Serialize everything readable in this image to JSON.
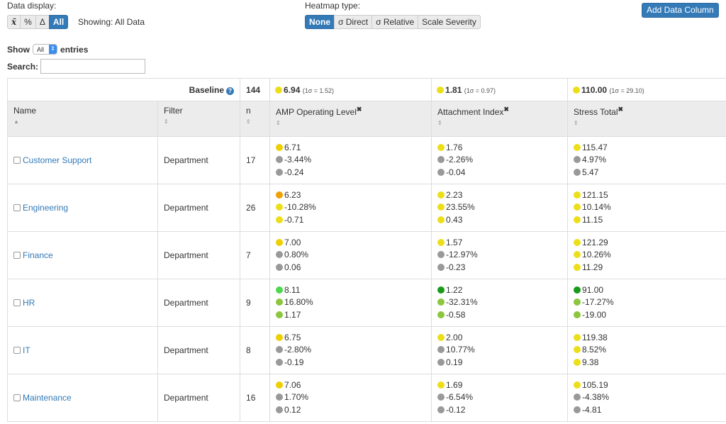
{
  "controls": {
    "data_display_label": "Data display:",
    "data_display_buttons": [
      {
        "label": "x̄",
        "active": false
      },
      {
        "label": "%",
        "active": false
      },
      {
        "label": "Δ",
        "active": false
      },
      {
        "label": "All",
        "active": true
      }
    ],
    "showing_text": "Showing: All Data",
    "heatmap_label": "Heatmap type:",
    "heatmap_buttons": [
      {
        "label": "None",
        "active": true
      },
      {
        "label": "σ Direct",
        "active": false
      },
      {
        "label": "σ Relative",
        "active": false
      },
      {
        "label": "Scale Severity",
        "active": false
      }
    ],
    "add_column_label": "Add Data Column",
    "show_label": "Show",
    "show_value": "All",
    "entries_label": "entries",
    "search_label": "Search:",
    "search_value": ""
  },
  "colors": {
    "yellow": "#ecdf1a",
    "gold": "#f0cf00",
    "orange": "#f0a000",
    "gray": "#999999",
    "lightgreen": "#8cc63e",
    "brightgreen": "#4cd94c",
    "darkgreen": "#1a9a1a",
    "primary": "#337ab7"
  },
  "baseline": {
    "label": "Baseline",
    "n": "144",
    "values": [
      {
        "value": "6.94",
        "sigma": "(1σ = 1.52)",
        "color": "yellow"
      },
      {
        "value": "1.81",
        "sigma": "(1σ = 0.97)",
        "color": "yellow"
      },
      {
        "value": "110.00",
        "sigma": "(1σ = 29.10)",
        "color": "yellow"
      }
    ]
  },
  "columns": [
    {
      "label": "Name",
      "sort": "▲"
    },
    {
      "label": "Filter",
      "sort": "⇕"
    },
    {
      "label": "n",
      "sort": "⇕"
    },
    {
      "label": "AMP Operating Level",
      "sort": "⇕",
      "removable": "✖"
    },
    {
      "label": "Attachment Index",
      "sort": "⇕",
      "removable": "✖"
    },
    {
      "label": "Stress Total",
      "sort": "⇕",
      "removable": "✖"
    }
  ],
  "rows": [
    {
      "name": "Customer Support",
      "filter": "Department",
      "n": "17",
      "metrics": [
        [
          {
            "v": "6.71",
            "c": "gold"
          },
          {
            "v": "-3.44%",
            "c": "gray"
          },
          {
            "v": "-0.24",
            "c": "gray"
          }
        ],
        [
          {
            "v": "1.76",
            "c": "yellow"
          },
          {
            "v": "-2.26%",
            "c": "gray"
          },
          {
            "v": "-0.04",
            "c": "gray"
          }
        ],
        [
          {
            "v": "115.47",
            "c": "yellow"
          },
          {
            "v": "4.97%",
            "c": "gray"
          },
          {
            "v": "5.47",
            "c": "gray"
          }
        ]
      ]
    },
    {
      "name": "Engineering",
      "filter": "Department",
      "n": "26",
      "metrics": [
        [
          {
            "v": "6.23",
            "c": "orange"
          },
          {
            "v": "-10.28%",
            "c": "yellow"
          },
          {
            "v": "-0.71",
            "c": "yellow"
          }
        ],
        [
          {
            "v": "2.23",
            "c": "yellow"
          },
          {
            "v": "23.55%",
            "c": "yellow"
          },
          {
            "v": "0.43",
            "c": "yellow"
          }
        ],
        [
          {
            "v": "121.15",
            "c": "yellow"
          },
          {
            "v": "10.14%",
            "c": "yellow"
          },
          {
            "v": "11.15",
            "c": "yellow"
          }
        ]
      ]
    },
    {
      "name": "Finance",
      "filter": "Department",
      "n": "7",
      "metrics": [
        [
          {
            "v": "7.00",
            "c": "gold"
          },
          {
            "v": "0.80%",
            "c": "gray"
          },
          {
            "v": "0.06",
            "c": "gray"
          }
        ],
        [
          {
            "v": "1.57",
            "c": "yellow"
          },
          {
            "v": "-12.97%",
            "c": "gray"
          },
          {
            "v": "-0.23",
            "c": "gray"
          }
        ],
        [
          {
            "v": "121.29",
            "c": "yellow"
          },
          {
            "v": "10.26%",
            "c": "yellow"
          },
          {
            "v": "11.29",
            "c": "yellow"
          }
        ]
      ]
    },
    {
      "name": "HR",
      "filter": "Department",
      "n": "9",
      "metrics": [
        [
          {
            "v": "8.11",
            "c": "brightgreen"
          },
          {
            "v": "16.80%",
            "c": "lightgreen"
          },
          {
            "v": "1.17",
            "c": "lightgreen"
          }
        ],
        [
          {
            "v": "1.22",
            "c": "darkgreen"
          },
          {
            "v": "-32.31%",
            "c": "lightgreen"
          },
          {
            "v": "-0.58",
            "c": "lightgreen"
          }
        ],
        [
          {
            "v": "91.00",
            "c": "darkgreen"
          },
          {
            "v": "-17.27%",
            "c": "lightgreen"
          },
          {
            "v": "-19.00",
            "c": "lightgreen"
          }
        ]
      ]
    },
    {
      "name": "IT",
      "filter": "Department",
      "n": "8",
      "metrics": [
        [
          {
            "v": "6.75",
            "c": "gold"
          },
          {
            "v": "-2.80%",
            "c": "gray"
          },
          {
            "v": "-0.19",
            "c": "gray"
          }
        ],
        [
          {
            "v": "2.00",
            "c": "yellow"
          },
          {
            "v": "10.77%",
            "c": "gray"
          },
          {
            "v": "0.19",
            "c": "gray"
          }
        ],
        [
          {
            "v": "119.38",
            "c": "yellow"
          },
          {
            "v": "8.52%",
            "c": "yellow"
          },
          {
            "v": "9.38",
            "c": "yellow"
          }
        ]
      ]
    },
    {
      "name": "Maintenance",
      "filter": "Department",
      "n": "16",
      "metrics": [
        [
          {
            "v": "7.06",
            "c": "gold"
          },
          {
            "v": "1.70%",
            "c": "gray"
          },
          {
            "v": "0.12",
            "c": "gray"
          }
        ],
        [
          {
            "v": "1.69",
            "c": "yellow"
          },
          {
            "v": "-6.54%",
            "c": "gray"
          },
          {
            "v": "-0.12",
            "c": "gray"
          }
        ],
        [
          {
            "v": "105.19",
            "c": "yellow"
          },
          {
            "v": "-4.38%",
            "c": "gray"
          },
          {
            "v": "-4.81",
            "c": "gray"
          }
        ]
      ]
    }
  ]
}
